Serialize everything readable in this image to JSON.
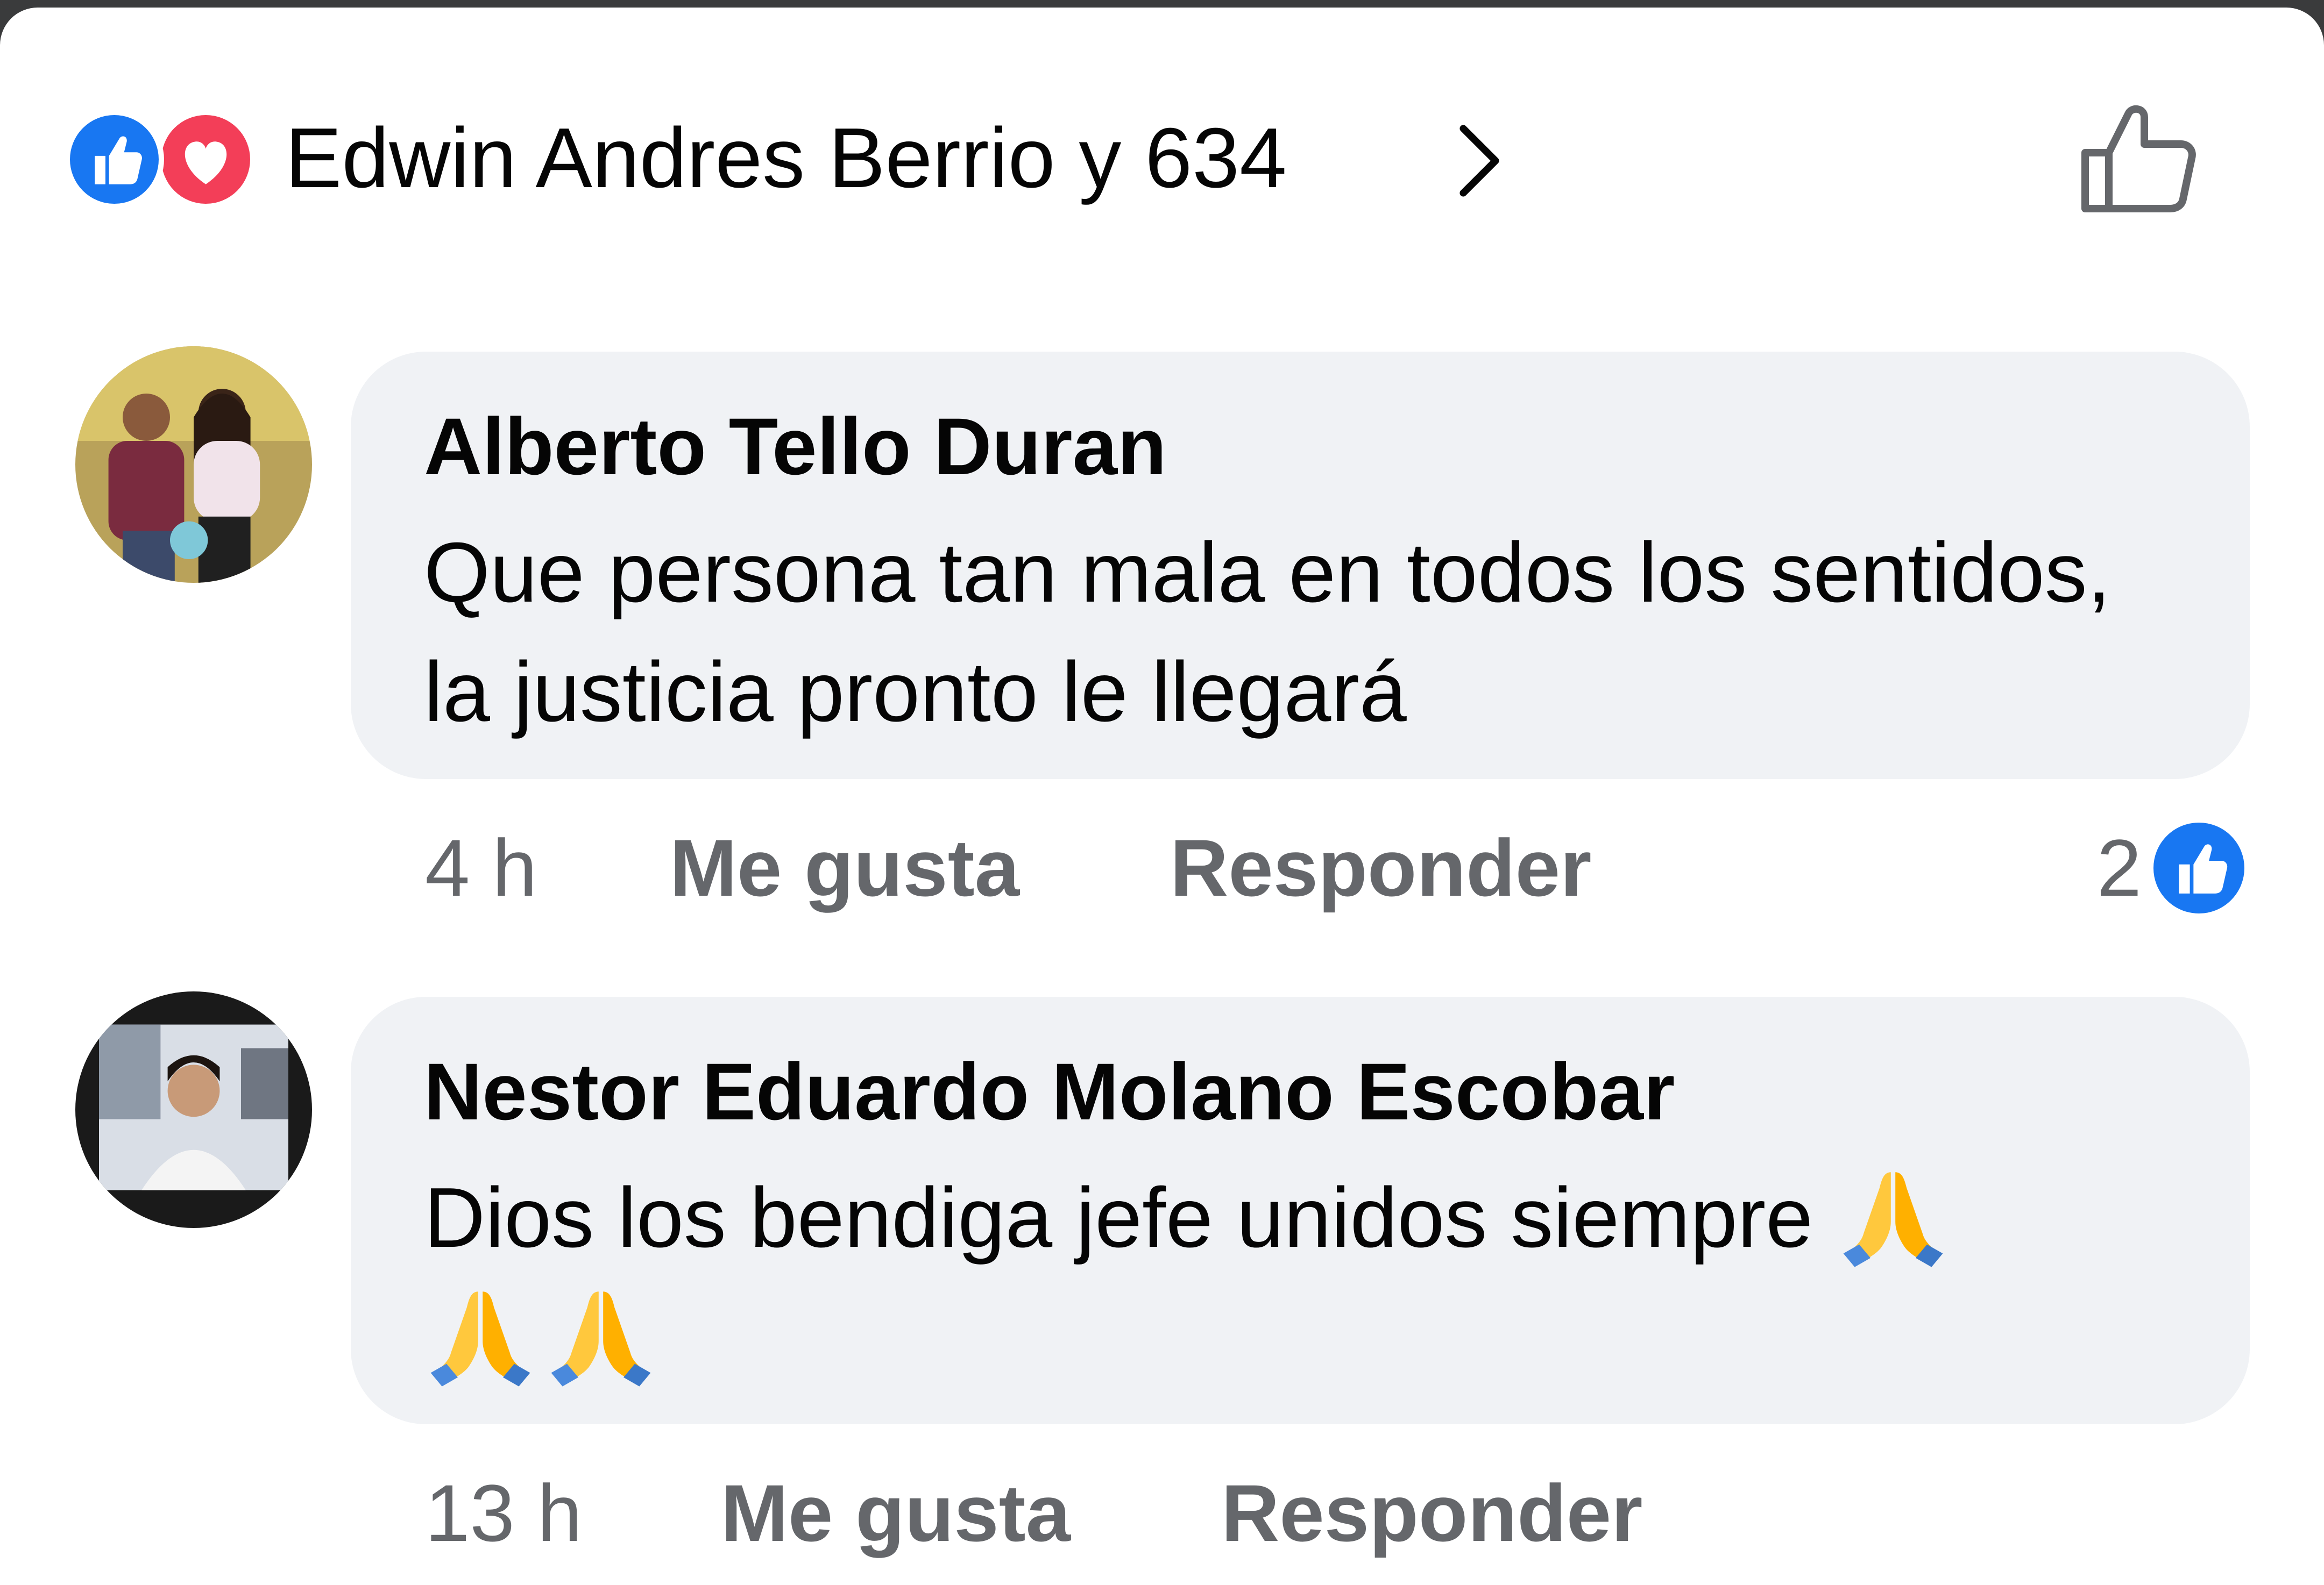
{
  "header": {
    "reaction_icons": [
      "like-icon",
      "love-icon"
    ],
    "reactors_text": "Edwin Andres Berrio y 634",
    "chevron_icon": "chevron-right-icon",
    "like_button_icon": "thumbs-up-outline-icon"
  },
  "colors": {
    "like_blue": "#1877f2",
    "love_red": "#f33e58",
    "bubble_gray": "#f0f2f5",
    "secondary_text": "#65676b"
  },
  "comments": [
    {
      "author": "Alberto Tello Duran",
      "text": "Que persona tan mala en todos los sentidos, la justicia pronto le llegará",
      "time": "4 h",
      "like_label": "Me gusta",
      "reply_label": "Responder",
      "reaction_count": "2",
      "reaction_icon": "like-icon"
    },
    {
      "author": "Nestor Eduardo Molano Escobar",
      "text": "Dios los bendiga jefe unidos siempre",
      "emojis": [
        "folded-hands-emoji",
        "folded-hands-emoji",
        "folded-hands-emoji"
      ],
      "time": "13 h",
      "like_label": "Me gusta",
      "reply_label": "Responder"
    }
  ]
}
